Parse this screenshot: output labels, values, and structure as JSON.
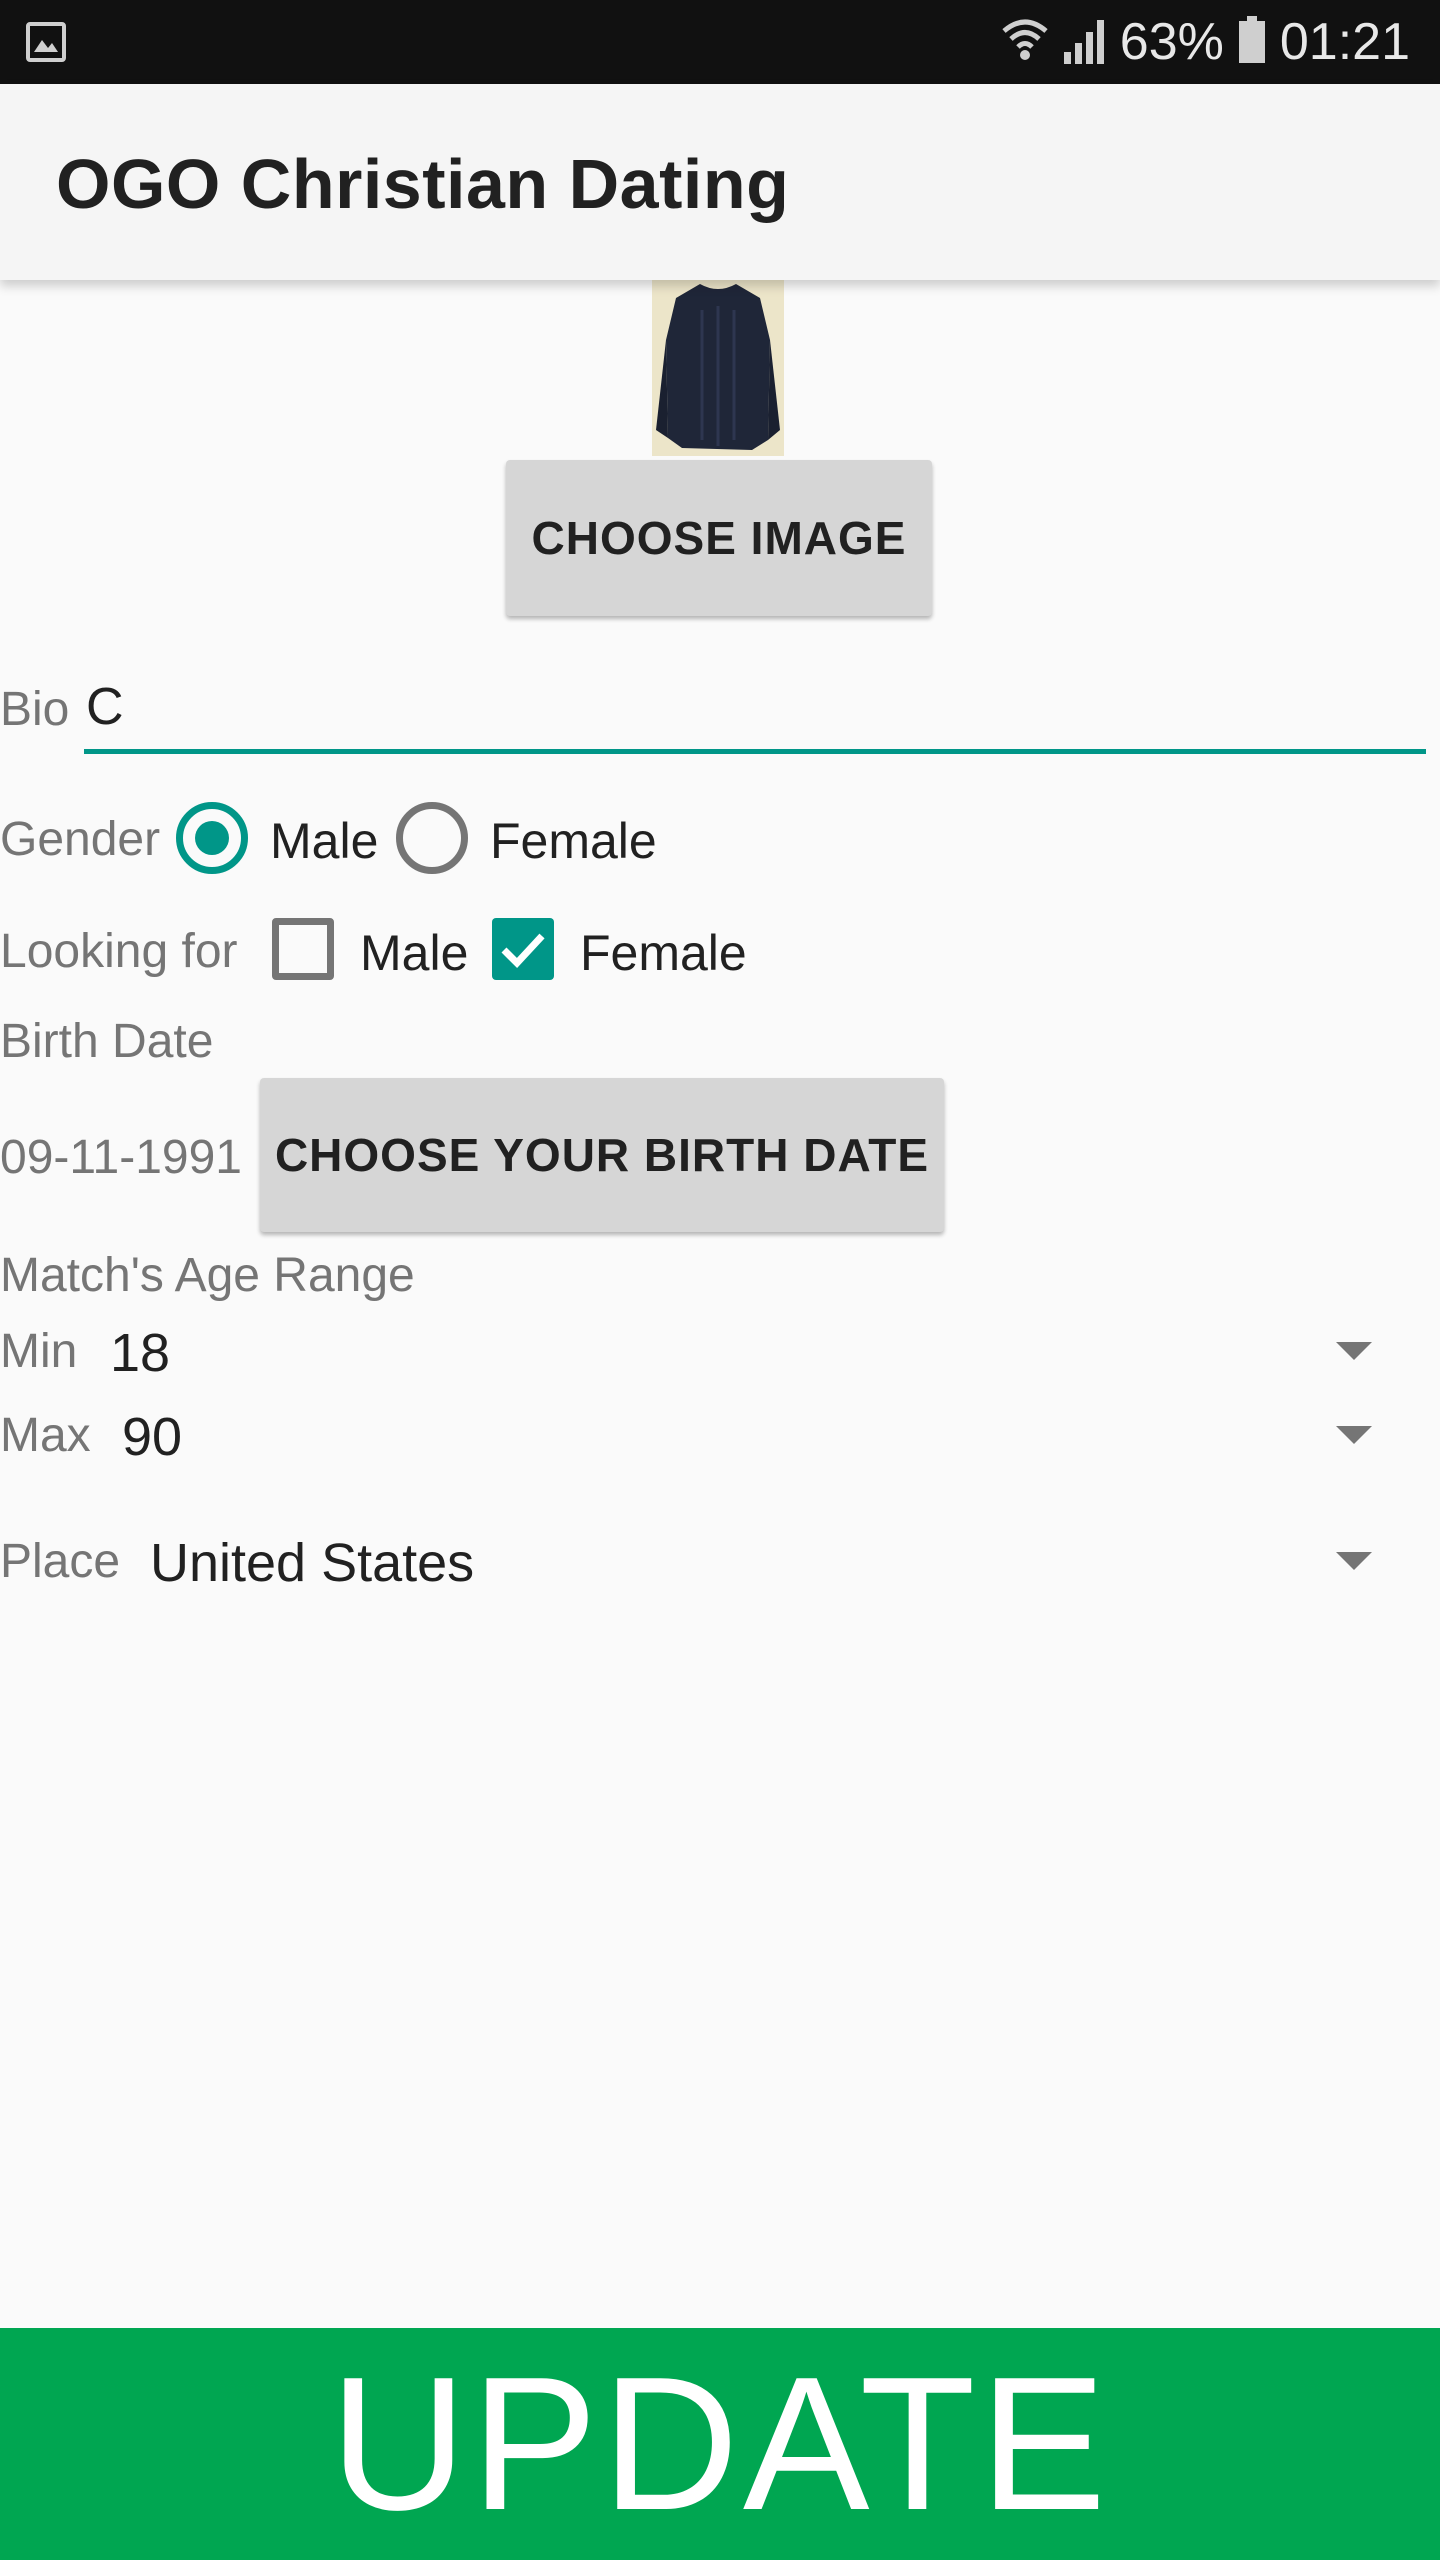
{
  "status_bar": {
    "battery": "63%",
    "time": "01:21",
    "icons": [
      "gallery-icon",
      "wifi-icon",
      "signal-icon",
      "battery-icon"
    ]
  },
  "app_bar": {
    "title": "OGO Christian Dating"
  },
  "profile": {
    "choose_image_label": "CHOOSE IMAGE"
  },
  "bio": {
    "label": "Bio",
    "value": "C"
  },
  "gender": {
    "label": "Gender",
    "options": [
      {
        "label": "Male",
        "selected": true
      },
      {
        "label": "Female",
        "selected": false
      }
    ]
  },
  "looking_for": {
    "label": "Looking for",
    "options": [
      {
        "label": "Male",
        "checked": false
      },
      {
        "label": "Female",
        "checked": true
      }
    ]
  },
  "birth_date": {
    "label": "Birth Date",
    "value": "09-11-1991",
    "button_label": "CHOOSE YOUR BIRTH DATE"
  },
  "age_range": {
    "label": "Match's Age Range",
    "min_label": "Min",
    "min_value": "18",
    "max_label": "Max",
    "max_value": "90"
  },
  "place": {
    "label": "Place",
    "value": "United States"
  },
  "update_label": "UPDATE",
  "colors": {
    "accent": "#009688",
    "update": "#00a651",
    "status_bar": "#111111",
    "app_bar": "#f5f5f5",
    "button": "#d6d6d6"
  }
}
